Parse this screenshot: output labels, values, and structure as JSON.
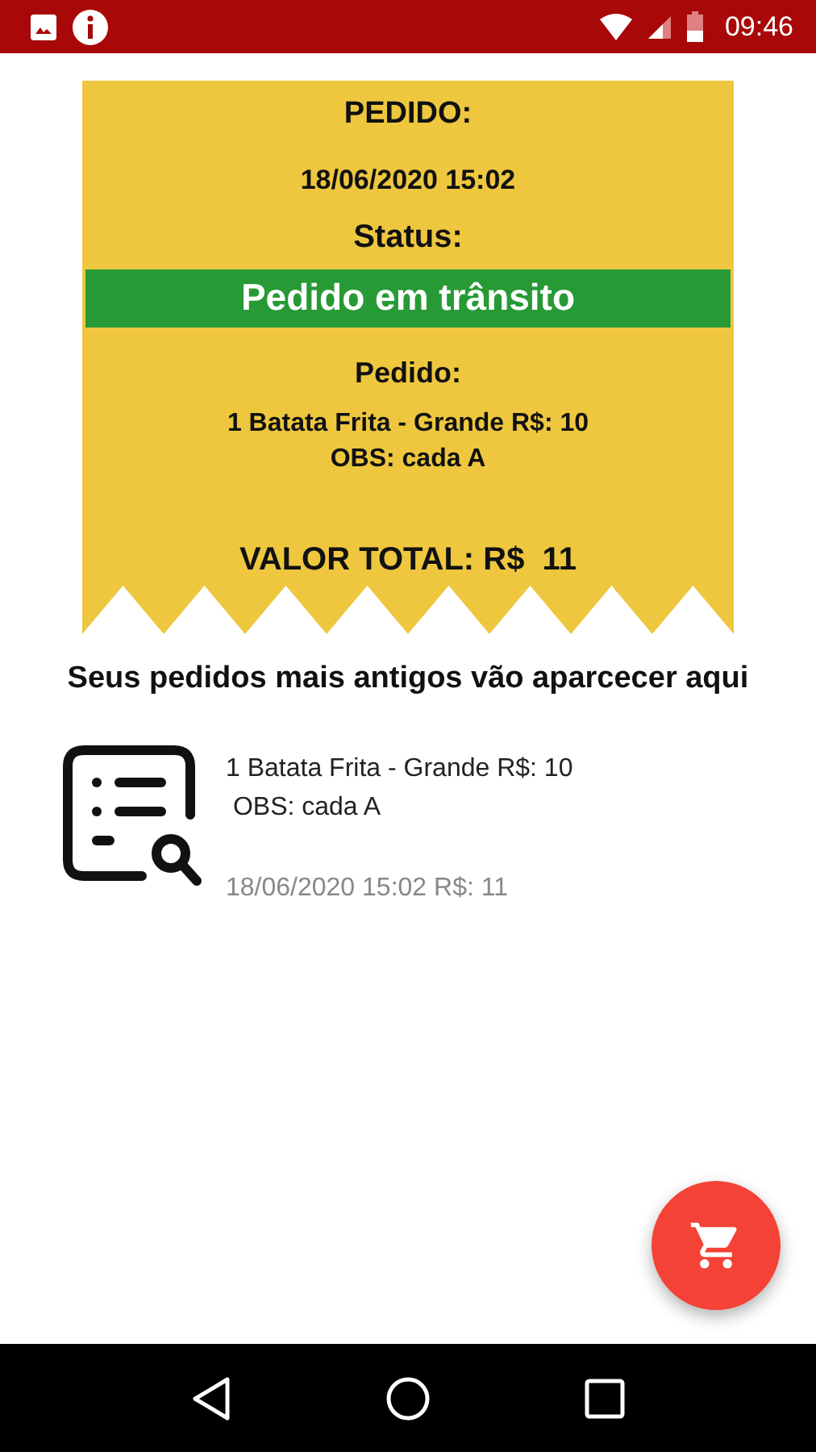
{
  "status_bar": {
    "time": "09:46"
  },
  "order": {
    "title": "PEDIDO:",
    "date": "18/06/2020 15:02",
    "status_label": "Status:",
    "status": "Pedido em trânsito",
    "items_label": "Pedido:",
    "item_lines": [
      "1 Batata Frita - Grande R$: 10",
      "OBS: cada A"
    ],
    "total": "VALOR TOTAL: R$  11"
  },
  "history": {
    "heading": "Seus pedidos mais antigos vão aparcecer aqui",
    "orders": [
      {
        "lines": [
          "1 Batata Frita - Grande R$: 10",
          " OBS: cada A"
        ],
        "footer": "18/06/2020 15:02 R$: 11"
      }
    ]
  }
}
